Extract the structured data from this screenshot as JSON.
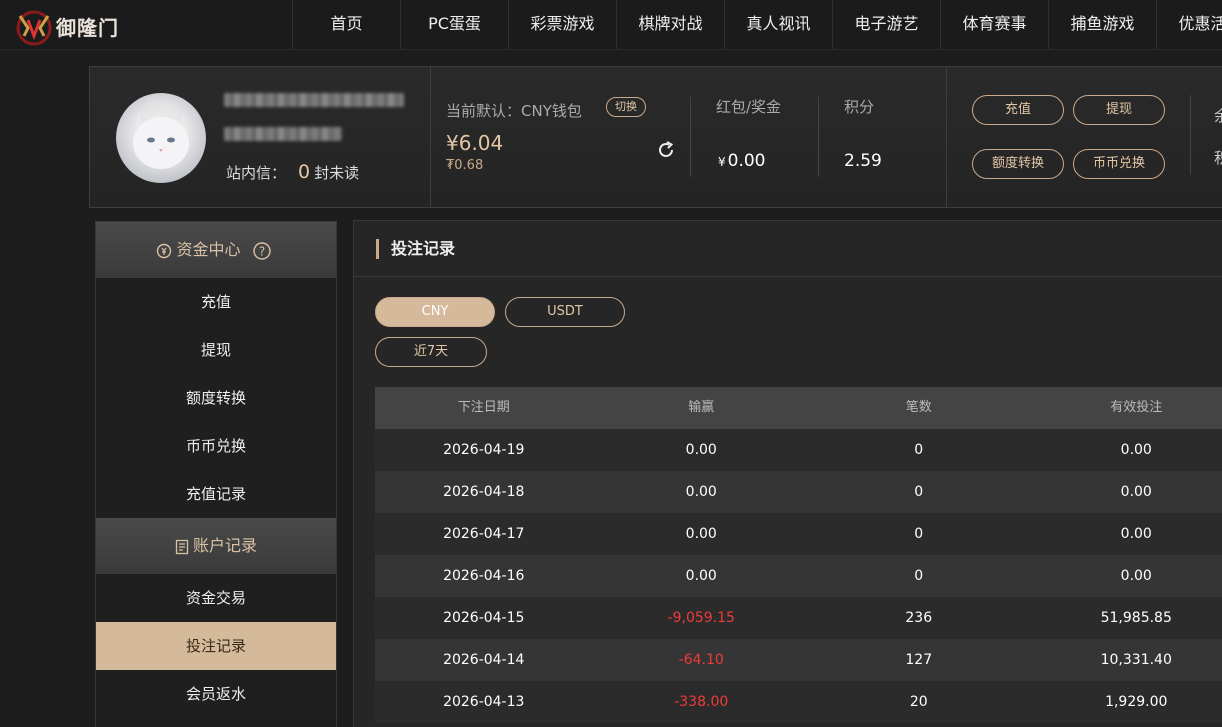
{
  "header": {
    "logo_text": "御隆门",
    "nav": [
      "首页",
      "PC蛋蛋",
      "彩票游戏",
      "棋牌对战",
      "真人视讯",
      "电子游艺",
      "体育赛事",
      "捕鱼游戏",
      "优惠活动"
    ]
  },
  "user_panel": {
    "inbox_label": "站内信：",
    "inbox_count": "0",
    "inbox_suffix": "封未读",
    "wallet_label": "当前默认：CNY钱包",
    "switch_label": "切换",
    "wallet_main": "¥6.04",
    "wallet_sub": "₮0.68",
    "stats": [
      {
        "label": "红包/奖金",
        "currency": "¥",
        "value": "0.00"
      },
      {
        "label": "积分",
        "currency": "",
        "value": "2.59"
      }
    ],
    "actions": [
      "充值",
      "提现",
      "额度转换",
      "币币兑换"
    ],
    "clipped_texts": [
      "余",
      "积"
    ]
  },
  "sidebar": {
    "section1_title": "资金中心",
    "section1_items": [
      "充值",
      "提现",
      "额度转换",
      "币币兑换",
      "充值记录"
    ],
    "section2_title": "账户记录",
    "section2_items": [
      "资金交易",
      "投注记录",
      "会员返水"
    ],
    "active_item": "投注记录"
  },
  "main": {
    "title": "投注记录",
    "currency_tabs": [
      "CNY",
      "USDT"
    ],
    "selected_currency": "CNY",
    "range_label": "近7天",
    "table": {
      "headers": [
        "下注日期",
        "输赢",
        "笔数",
        "有效投注"
      ],
      "rows": [
        {
          "date": "2026-04-19",
          "winloss": "0.00",
          "count": "0",
          "valid": "0.00"
        },
        {
          "date": "2026-04-18",
          "winloss": "0.00",
          "count": "0",
          "valid": "0.00"
        },
        {
          "date": "2026-04-17",
          "winloss": "0.00",
          "count": "0",
          "valid": "0.00"
        },
        {
          "date": "2026-04-16",
          "winloss": "0.00",
          "count": "0",
          "valid": "0.00"
        },
        {
          "date": "2026-04-15",
          "winloss": "-9,059.15",
          "count": "236",
          "valid": "51,985.85"
        },
        {
          "date": "2026-04-14",
          "winloss": "-64.10",
          "count": "127",
          "valid": "10,331.40"
        },
        {
          "date": "2026-04-13",
          "winloss": "-338.00",
          "count": "20",
          "valid": "1,929.00"
        }
      ]
    }
  },
  "colors": {
    "accent": "#d4b99a",
    "gold_text": "#e3c7a5",
    "negative": "#ee3b3b"
  }
}
